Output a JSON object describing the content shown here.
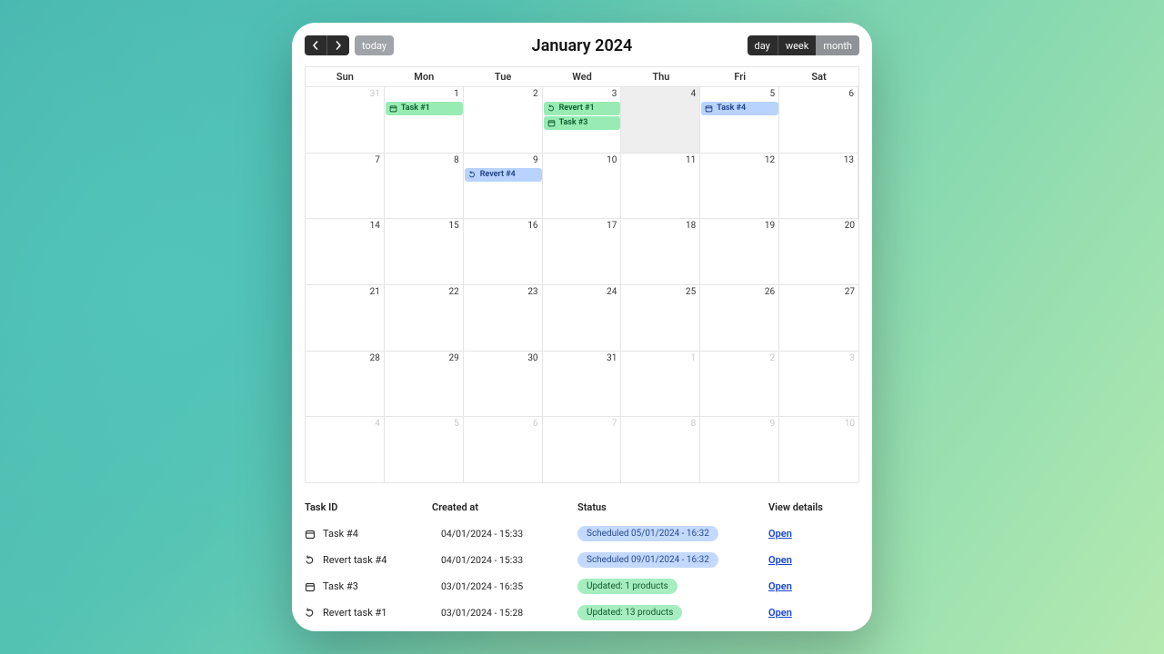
{
  "toolbar": {
    "today_label": "today",
    "title": "January 2024",
    "views": {
      "day": "day",
      "week": "week",
      "month": "month"
    }
  },
  "calendar": {
    "dow": [
      "Sun",
      "Mon",
      "Tue",
      "Wed",
      "Thu",
      "Fri",
      "Sat"
    ],
    "today_date": "4",
    "events": [
      {
        "id": "e1",
        "label": "Task #1",
        "color": "green",
        "kind": "task",
        "row": 0,
        "slot": 2,
        "c1": 2,
        "c2": 3
      },
      {
        "id": "e2",
        "label": "Revert #1",
        "color": "green",
        "kind": "revert",
        "row": 0,
        "slot": 2,
        "c1": 4,
        "c2": 5
      },
      {
        "id": "e3",
        "label": "Task #3",
        "color": "green",
        "kind": "task",
        "row": 0,
        "slot": 3,
        "c1": 4,
        "c2": 5
      },
      {
        "id": "e4",
        "label": "Task #4",
        "color": "blue",
        "kind": "task",
        "row": 0,
        "slot": 2,
        "c1": 6,
        "c2": 7
      },
      {
        "id": "e5",
        "label": "Revert #4",
        "color": "blue",
        "kind": "revert",
        "row": 1,
        "slot": 2,
        "c1": 3,
        "c2": 4
      }
    ],
    "weeks": [
      [
        {
          "n": "31",
          "other": true
        },
        {
          "n": "1"
        },
        {
          "n": "2"
        },
        {
          "n": "3"
        },
        {
          "n": "4",
          "today": true
        },
        {
          "n": "5"
        },
        {
          "n": "6"
        }
      ],
      [
        {
          "n": "7"
        },
        {
          "n": "8"
        },
        {
          "n": "9"
        },
        {
          "n": "10"
        },
        {
          "n": "11"
        },
        {
          "n": "12"
        },
        {
          "n": "13"
        }
      ],
      [
        {
          "n": "14"
        },
        {
          "n": "15"
        },
        {
          "n": "16"
        },
        {
          "n": "17"
        },
        {
          "n": "18"
        },
        {
          "n": "19"
        },
        {
          "n": "20"
        }
      ],
      [
        {
          "n": "21"
        },
        {
          "n": "22"
        },
        {
          "n": "23"
        },
        {
          "n": "24"
        },
        {
          "n": "25"
        },
        {
          "n": "26"
        },
        {
          "n": "27"
        }
      ],
      [
        {
          "n": "28"
        },
        {
          "n": "29"
        },
        {
          "n": "30"
        },
        {
          "n": "31"
        },
        {
          "n": "1",
          "other": true
        },
        {
          "n": "2",
          "other": true
        },
        {
          "n": "3",
          "other": true
        }
      ],
      [
        {
          "n": "4",
          "other": true
        },
        {
          "n": "5",
          "other": true
        },
        {
          "n": "6",
          "other": true
        },
        {
          "n": "7",
          "other": true
        },
        {
          "n": "8",
          "other": true
        },
        {
          "n": "9",
          "other": true
        },
        {
          "n": "10",
          "other": true
        }
      ]
    ]
  },
  "table": {
    "headers": {
      "id": "Task ID",
      "created": "Created at",
      "status": "Status",
      "details": "View details"
    },
    "open_label": "Open",
    "rows": [
      {
        "kind": "task",
        "id": "Task #4",
        "created": "04/01/2024 - 15:33",
        "status": "Scheduled 05/01/2024 - 16:32",
        "badge": "blue"
      },
      {
        "kind": "revert",
        "id": "Revert task #4",
        "created": "04/01/2024 - 15:33",
        "status": "Scheduled 09/01/2024 - 16:32",
        "badge": "blue"
      },
      {
        "kind": "task",
        "id": "Task #3",
        "created": "03/01/2024 - 16:35",
        "status": "Updated: 1 products",
        "badge": "green"
      },
      {
        "kind": "revert",
        "id": "Revert task #1",
        "created": "03/01/2024 - 15:28",
        "status": "Updated: 13 products",
        "badge": "green"
      }
    ]
  }
}
